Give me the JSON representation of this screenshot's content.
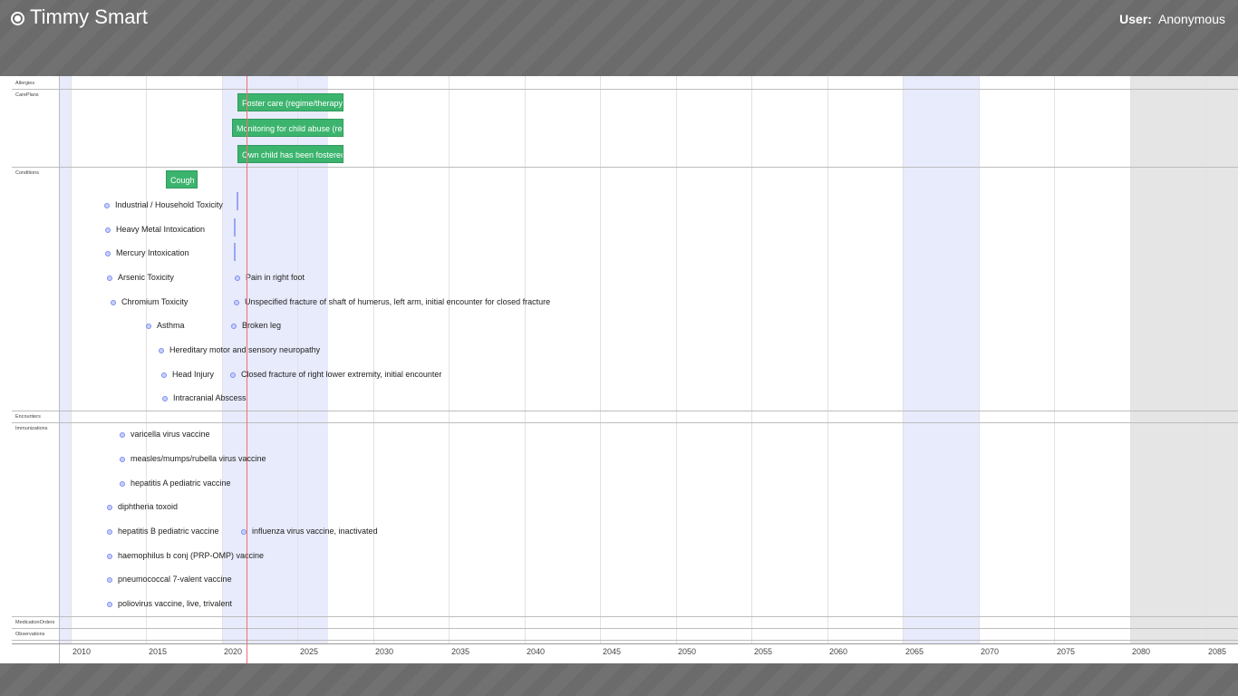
{
  "header": {
    "patient_name": "Timmy Smart",
    "user_label": "User:",
    "user_name": "Anonymous"
  },
  "rows": {
    "allergies": "Allergies",
    "careplans": "CarePlans",
    "conditions": "Conditions",
    "encounters": "Encounters",
    "immunizations": "Immunizations",
    "medication_orders": "MedicationOrders",
    "observations": "Observations"
  },
  "careplans": [
    "Foster care (regime/therapy)",
    "Monitoring for child abuse (regime/therapy)",
    "Own child has been fostered"
  ],
  "conditions": {
    "cough": "Cough",
    "items": [
      "Industrial / Household Toxicity",
      "Heavy Metal Intoxication",
      "Mercury Intoxication",
      "Arsenic Toxicity",
      "Chromium Toxicity",
      "Asthma",
      "Hereditary motor and sensory neuropathy",
      "Head Injury",
      "Intracranial Abscess",
      "Pain in right foot",
      "Unspecified fracture of shaft of humerus, left arm, initial encounter for closed fracture",
      "Broken leg",
      "Closed fracture of right lower extremity, initial encounter"
    ]
  },
  "immunizations": [
    "varicella virus vaccine",
    "measles/mumps/rubella virus vaccine",
    "hepatitis A pediatric vaccine",
    "diphtheria toxoid",
    "hepatitis B pediatric vaccine",
    "influenza virus vaccine, inactivated",
    "haemophilus b conj (PRP-OMP) vaccine",
    "pneumococcal 7-valent vaccine",
    "poliovirus vaccine, live, trivalent"
  ],
  "axis": {
    "years": [
      "2010",
      "2015",
      "2020",
      "2025",
      "2030",
      "2035",
      "2040",
      "2045",
      "2050",
      "2055",
      "2060",
      "2065",
      "2070",
      "2075",
      "2080",
      "2085"
    ]
  },
  "colors": {
    "careplan_green": "#3cb46e",
    "now_line": "#f07070",
    "highlight_band": "#e8ebfc",
    "future_band": "#e5e5e5"
  }
}
